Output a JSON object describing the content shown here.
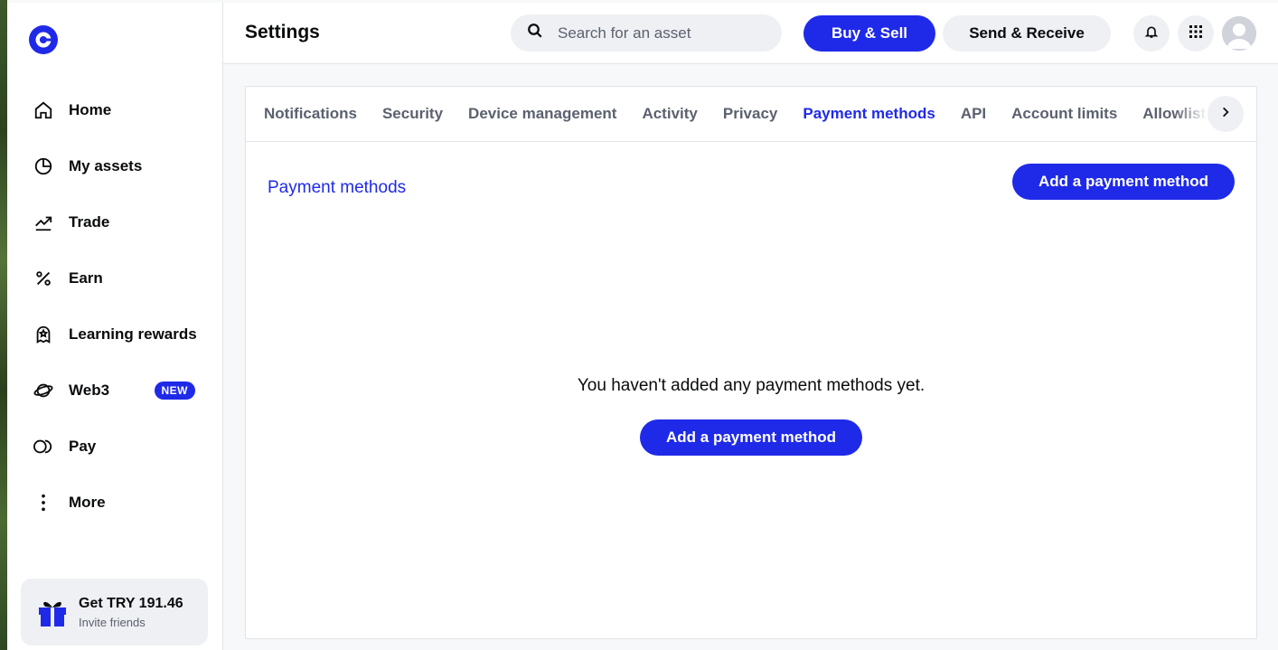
{
  "colors": {
    "brand": "#1f2ae8",
    "text": "#0a0b0d",
    "muted": "#5b616e",
    "surface": "#eef0f3"
  },
  "sidebar": {
    "logo_icon": "coinbase-logo",
    "items": [
      {
        "label": "Home",
        "icon": "home-icon"
      },
      {
        "label": "My assets",
        "icon": "pie-chart-icon"
      },
      {
        "label": "Trade",
        "icon": "trend-icon"
      },
      {
        "label": "Earn",
        "icon": "percent-icon"
      },
      {
        "label": "Learning rewards",
        "icon": "reward-icon"
      },
      {
        "label": "Web3",
        "icon": "web3-icon",
        "badge": "NEW"
      },
      {
        "label": "Pay",
        "icon": "pay-icon"
      },
      {
        "label": "More",
        "icon": "more-vertical-icon"
      }
    ],
    "referral": {
      "title": "Get TRY 191.46",
      "subtitle": "Invite friends",
      "icon": "gift-icon"
    }
  },
  "header": {
    "title": "Settings",
    "search": {
      "placeholder": "Search for an asset",
      "value": ""
    },
    "buy_sell_label": "Buy & Sell",
    "send_receive_label": "Send & Receive",
    "notification_icon": "bell-icon",
    "apps_icon": "grid-icon",
    "avatar_icon": "user-avatar"
  },
  "settings": {
    "tabs": [
      {
        "label": "Notifications",
        "active": false
      },
      {
        "label": "Security",
        "active": false
      },
      {
        "label": "Device management",
        "active": false
      },
      {
        "label": "Activity",
        "active": false
      },
      {
        "label": "Privacy",
        "active": false
      },
      {
        "label": "Payment methods",
        "active": true
      },
      {
        "label": "API",
        "active": false
      },
      {
        "label": "Account limits",
        "active": false
      },
      {
        "label": "Allowlist",
        "active": false
      }
    ],
    "section_title": "Payment methods",
    "add_button_label": "Add a payment method",
    "empty_message": "You haven't added any payment methods yet.",
    "empty_add_button_label": "Add a payment method"
  }
}
